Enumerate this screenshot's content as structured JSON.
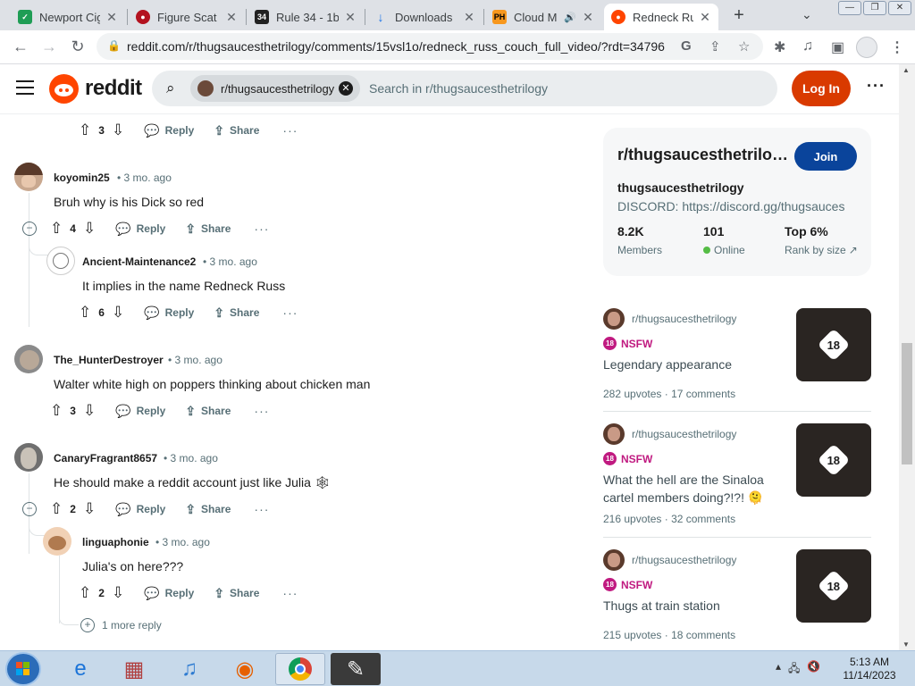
{
  "browser": {
    "tabs": [
      {
        "title": "Newport Cig",
        "color": "#1f9d55",
        "glyph": "✓"
      },
      {
        "title": "Figure Scat",
        "color": "#b3121f",
        "glyph": "●"
      },
      {
        "title": "Rule 34 - 1b",
        "color": "#222222",
        "glyph": "34"
      },
      {
        "title": "Downloads",
        "color": "#1a73e8",
        "glyph": "↓"
      },
      {
        "title": "Cloud M",
        "color": "#f7971d",
        "glyph": "PH"
      },
      {
        "title": "Redneck Rus",
        "color": "#ff4500",
        "glyph": "●"
      }
    ],
    "url": "reddit.com/r/thugsaucesthetrilogy/comments/15vsl1o/redneck_russ_couch_full_video/?rdt=34796",
    "new_tab": "+"
  },
  "header": {
    "logo": "reddit",
    "subreddit_chip": "r/thugsaucesthetrilogy",
    "search_placeholder": "Search in r/thugsaucesthetrilogy",
    "login": "Log In",
    "more": "···"
  },
  "actions": {
    "reply": "Reply",
    "share": "Share",
    "more": "···"
  },
  "comments": [
    {
      "score": "3"
    },
    {
      "author": "koyomin25",
      "time": "• 3 mo. ago",
      "text": "Bruh why is his Dick so red",
      "score": "4"
    },
    {
      "author": "Ancient-Maintenance2",
      "time": "• 3 mo. ago",
      "text": "It implies in the name Redneck Russ",
      "score": "6"
    },
    {
      "author": "The_HunterDestroyer",
      "time": "• 3 mo. ago",
      "text": "Walter white high on poppers thinking about chicken man",
      "score": "3"
    },
    {
      "author": "CanaryFragrant8657",
      "time": "• 3 mo. ago",
      "text": "He should make a reddit account just like Julia 🕸",
      "score": "2"
    },
    {
      "author": "linguaphonie",
      "time": "• 3 mo. ago",
      "text": "Julia's on here???",
      "score": "2"
    }
  ],
  "more_replies": "1 more reply",
  "sidebar": {
    "name": "r/thugsaucesthetrilogy",
    "join": "Join",
    "title": "thugsaucesthetrilogy",
    "description": "DISCORD: https://discord.gg/thugsauces",
    "stats": [
      {
        "value": "8.2K",
        "label": "Members"
      },
      {
        "value": "101",
        "label": "Online"
      },
      {
        "value": "Top 6%",
        "label": "Rank by size"
      }
    ]
  },
  "posts": [
    {
      "subreddit": "r/thugsaucesthetrilogy",
      "nsfw": "NSFW",
      "title": "Legendary appearance",
      "upvotes": "282 upvotes",
      "comments": "17 comments"
    },
    {
      "subreddit": "r/thugsaucesthetrilogy",
      "nsfw": "NSFW",
      "title": "What the hell are the Sinaloa cartel members doing?!?! 🫠",
      "upvotes": "216 upvotes",
      "comments": "32 comments"
    },
    {
      "subreddit": "r/thugsaucesthetrilogy",
      "nsfw": "NSFW",
      "title": "Thugs at train station",
      "upvotes": "215 upvotes",
      "comments": "18 comments"
    }
  ],
  "taskbar": {
    "time": "5:13 AM",
    "date": "11/14/2023"
  }
}
